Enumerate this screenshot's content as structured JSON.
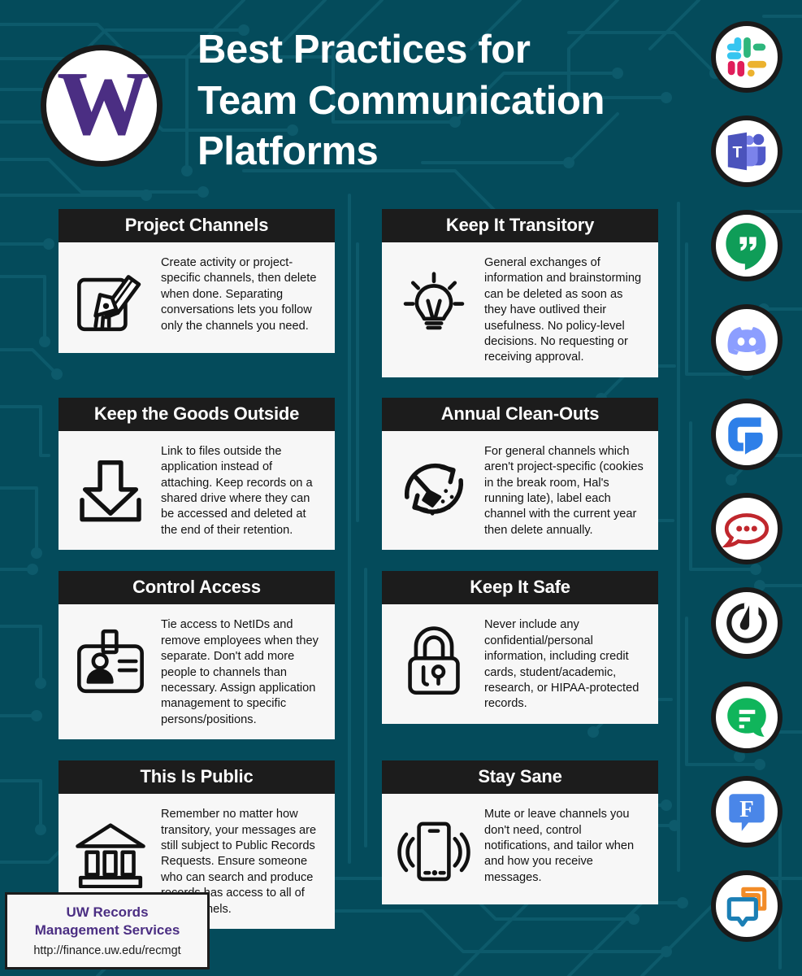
{
  "theme": {
    "background": "#044b5b",
    "trace": "#0e5a6a",
    "card_bg": "#f7f7f7",
    "card_header_bg": "#1c1c1c",
    "accent_purple": "#4b2e83",
    "text_dark": "#121212",
    "white": "#ffffff"
  },
  "header": {
    "logo_letter": "W",
    "logo_name": "uw-w-logo",
    "title_line1": "Best Practices for",
    "title_line2": "Team Communication",
    "title_line3": "Platforms",
    "title_full": "Best Practices for Team Communication Platforms"
  },
  "cards": [
    {
      "id": "project-channels",
      "title": "Project Channels",
      "icon": "hand-writing-note-icon",
      "body": "Create activity or project-specific channels, then delete when done. Separating conversations lets you follow only the channels you need."
    },
    {
      "id": "keep-it-transitory",
      "title": "Keep It Transitory",
      "icon": "lightbulb-icon",
      "body": "General exchanges of information and brainstorming can be deleted as soon as they have outlived their usefulness. No policy-level decisions. No requesting or receiving approval."
    },
    {
      "id": "keep-the-goods-outside",
      "title": "Keep the Goods Outside",
      "icon": "download-arrow-icon",
      "body": "Link to files outside the application instead of attaching. Keep records on a shared drive where they can be accessed and deleted at the end of their retention."
    },
    {
      "id": "annual-clean-outs",
      "title": "Annual Clean-Outs",
      "icon": "broom-refresh-icon",
      "body": "For general channels which aren't project-specific (cookies in the break room, Hal's running late), label each channel with the current year then delete annually."
    },
    {
      "id": "control-access",
      "title": "Control Access",
      "icon": "id-badge-icon",
      "body": "Tie access to NetIDs and remove employees when they separate. Don't add more people to channels than necessary. Assign application management to specific persons/positions."
    },
    {
      "id": "keep-it-safe",
      "title": "Keep It Safe",
      "icon": "padlock-icon",
      "body": "Never include any confidential/personal information, including credit cards, student/academic, research, or HIPAA-protected records."
    },
    {
      "id": "this-is-public",
      "title": "This Is Public",
      "icon": "bank-building-icon",
      "body": "Remember no matter how transitory, your messages are still subject to Public Records Requests. Ensure someone who can search and produce records has access to all of the channels."
    },
    {
      "id": "stay-sane",
      "title": "Stay Sane",
      "icon": "vibrating-phone-icon",
      "body": "Mute or leave channels you don't need, control notifications, and tailor when and how you receive messages."
    }
  ],
  "app_icons": [
    {
      "id": "slack",
      "name": "slack-icon",
      "label": "Slack"
    },
    {
      "id": "microsoft-teams",
      "name": "microsoft-teams-icon",
      "label": "Microsoft Teams"
    },
    {
      "id": "google-hangouts",
      "name": "google-hangouts-icon",
      "label": "Google Hangouts"
    },
    {
      "id": "discord",
      "name": "discord-icon",
      "label": "Discord"
    },
    {
      "id": "chatwork",
      "name": "chatwork-icon",
      "label": "Chatwork"
    },
    {
      "id": "rocket-chat",
      "name": "rocket-chat-icon",
      "label": "Rocket.Chat"
    },
    {
      "id": "mattermost",
      "name": "mattermost-icon",
      "label": "Mattermost"
    },
    {
      "id": "flock",
      "name": "flock-icon",
      "label": "Flock"
    },
    {
      "id": "fleep",
      "name": "fleep-icon",
      "label": "Fleep"
    },
    {
      "id": "ryver",
      "name": "ryver-icon",
      "label": "Ryver"
    }
  ],
  "footer": {
    "org_line1": "UW Records",
    "org_line2": "Management Services",
    "url": "http://finance.uw.edu/recmgt"
  }
}
